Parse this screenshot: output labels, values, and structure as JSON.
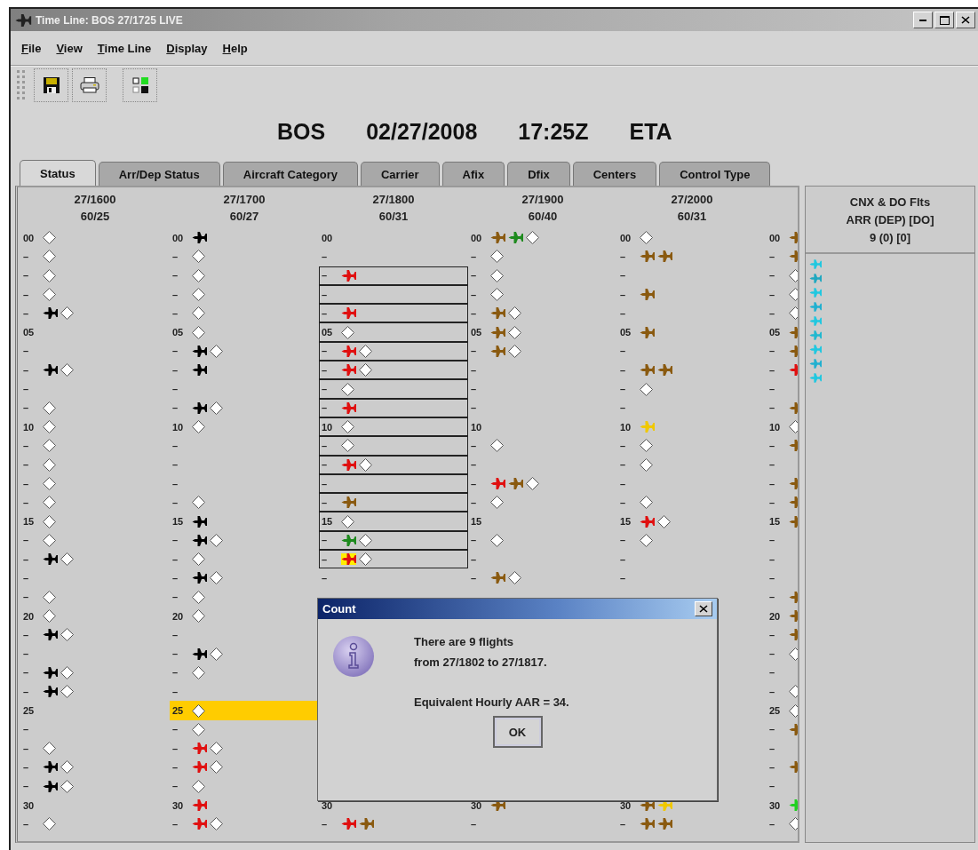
{
  "window": {
    "title": "Time Line: BOS 27/1725 LIVE"
  },
  "menu": [
    "File",
    "View",
    "Time Line",
    "Display",
    "Help"
  ],
  "heading": [
    "BOS",
    "02/27/2008",
    "17:25Z",
    "ETA"
  ],
  "tabs": [
    {
      "label": "Status",
      "selected": true
    },
    {
      "label": "Arr/Dep Status",
      "selected": false
    },
    {
      "label": "Aircraft Category",
      "selected": false
    },
    {
      "label": "Carrier",
      "selected": false
    },
    {
      "label": "Afix",
      "selected": false
    },
    {
      "label": "Dfix",
      "selected": false
    },
    {
      "label": "Centers",
      "selected": false
    },
    {
      "label": "Control Type",
      "selected": false
    }
  ],
  "columns": [
    {
      "time": "27/1600",
      "rate": "60/25",
      "rows": [
        {
          "label": "00",
          "marks": [
            {
              "kind": "diamond"
            }
          ]
        },
        {
          "label": "–",
          "marks": [
            {
              "kind": "diamond"
            }
          ]
        },
        {
          "label": "–",
          "marks": [
            {
              "kind": "diamond"
            }
          ]
        },
        {
          "label": "–",
          "marks": [
            {
              "kind": "diamond"
            }
          ]
        },
        {
          "label": "–",
          "marks": [
            {
              "kind": "plane",
              "color": "#000000"
            },
            {
              "kind": "diamond"
            }
          ]
        },
        {
          "label": "05"
        },
        {
          "label": "–"
        },
        {
          "label": "–",
          "marks": [
            {
              "kind": "plane",
              "color": "#000000"
            },
            {
              "kind": "diamond"
            }
          ]
        },
        {
          "label": "–"
        },
        {
          "label": "–",
          "marks": [
            {
              "kind": "diamond"
            }
          ]
        },
        {
          "label": "10",
          "marks": [
            {
              "kind": "diamond"
            }
          ]
        },
        {
          "label": "–",
          "marks": [
            {
              "kind": "diamond"
            }
          ]
        },
        {
          "label": "–",
          "marks": [
            {
              "kind": "diamond"
            }
          ]
        },
        {
          "label": "–",
          "marks": [
            {
              "kind": "diamond"
            }
          ]
        },
        {
          "label": "–",
          "marks": [
            {
              "kind": "diamond"
            }
          ]
        },
        {
          "label": "15",
          "marks": [
            {
              "kind": "diamond"
            }
          ]
        },
        {
          "label": "–",
          "marks": [
            {
              "kind": "diamond"
            }
          ]
        },
        {
          "label": "–",
          "marks": [
            {
              "kind": "plane",
              "color": "#000000"
            },
            {
              "kind": "diamond"
            }
          ]
        },
        {
          "label": "–"
        },
        {
          "label": "–",
          "marks": [
            {
              "kind": "diamond"
            }
          ]
        },
        {
          "label": "20",
          "marks": [
            {
              "kind": "diamond"
            }
          ]
        },
        {
          "label": "–",
          "marks": [
            {
              "kind": "plane",
              "color": "#000000"
            },
            {
              "kind": "diamond"
            }
          ]
        },
        {
          "label": "–"
        },
        {
          "label": "–",
          "marks": [
            {
              "kind": "plane",
              "color": "#000000"
            },
            {
              "kind": "diamond"
            }
          ]
        },
        {
          "label": "–",
          "marks": [
            {
              "kind": "plane",
              "color": "#000000"
            },
            {
              "kind": "diamond"
            }
          ]
        },
        {
          "label": "25"
        },
        {
          "label": "–"
        },
        {
          "label": "–",
          "marks": [
            {
              "kind": "diamond"
            }
          ]
        },
        {
          "label": "–",
          "marks": [
            {
              "kind": "plane",
              "color": "#000000"
            },
            {
              "kind": "diamond"
            }
          ]
        },
        {
          "label": "–",
          "marks": [
            {
              "kind": "plane",
              "color": "#000000"
            },
            {
              "kind": "diamond"
            }
          ]
        },
        {
          "label": "30"
        },
        {
          "label": "–",
          "marks": [
            {
              "kind": "diamond"
            }
          ]
        }
      ]
    },
    {
      "time": "27/1700",
      "rate": "60/27",
      "rows": [
        {
          "label": "00",
          "marks": [
            {
              "kind": "plane",
              "color": "#000000"
            }
          ]
        },
        {
          "label": "–",
          "marks": [
            {
              "kind": "diamond"
            }
          ]
        },
        {
          "label": "–",
          "marks": [
            {
              "kind": "diamond"
            }
          ]
        },
        {
          "label": "–",
          "marks": [
            {
              "kind": "diamond"
            }
          ]
        },
        {
          "label": "–",
          "marks": [
            {
              "kind": "diamond"
            }
          ]
        },
        {
          "label": "05",
          "marks": [
            {
              "kind": "diamond"
            }
          ]
        },
        {
          "label": "–",
          "marks": [
            {
              "kind": "plane",
              "color": "#000000"
            },
            {
              "kind": "diamond"
            }
          ]
        },
        {
          "label": "–",
          "marks": [
            {
              "kind": "plane",
              "color": "#000000"
            }
          ]
        },
        {
          "label": "–"
        },
        {
          "label": "–",
          "marks": [
            {
              "kind": "plane",
              "color": "#000000"
            },
            {
              "kind": "diamond"
            }
          ]
        },
        {
          "label": "10",
          "marks": [
            {
              "kind": "diamond"
            }
          ]
        },
        {
          "label": "–"
        },
        {
          "label": "–"
        },
        {
          "label": "–"
        },
        {
          "label": "–",
          "marks": [
            {
              "kind": "diamond"
            }
          ]
        },
        {
          "label": "15",
          "marks": [
            {
              "kind": "plane",
              "color": "#000000"
            }
          ]
        },
        {
          "label": "–",
          "marks": [
            {
              "kind": "plane",
              "color": "#000000"
            },
            {
              "kind": "diamond"
            }
          ]
        },
        {
          "label": "–",
          "marks": [
            {
              "kind": "diamond"
            }
          ]
        },
        {
          "label": "–",
          "marks": [
            {
              "kind": "plane",
              "color": "#000000"
            },
            {
              "kind": "diamond"
            }
          ]
        },
        {
          "label": "–",
          "marks": [
            {
              "kind": "diamond"
            }
          ]
        },
        {
          "label": "20",
          "marks": [
            {
              "kind": "diamond"
            }
          ]
        },
        {
          "label": "–"
        },
        {
          "label": "–",
          "marks": [
            {
              "kind": "plane",
              "color": "#000000"
            },
            {
              "kind": "diamond"
            }
          ]
        },
        {
          "label": "–",
          "marks": [
            {
              "kind": "diamond"
            }
          ]
        },
        {
          "label": "–"
        },
        {
          "label": "25",
          "highlighted": true,
          "marks": [
            {
              "kind": "diamond"
            }
          ]
        },
        {
          "label": "–",
          "marks": [
            {
              "kind": "diamond"
            }
          ]
        },
        {
          "label": "–",
          "marks": [
            {
              "kind": "plane",
              "color": "#e01010"
            },
            {
              "kind": "diamond"
            }
          ]
        },
        {
          "label": "–",
          "marks": [
            {
              "kind": "plane",
              "color": "#e01010"
            },
            {
              "kind": "diamond"
            }
          ]
        },
        {
          "label": "–",
          "marks": [
            {
              "kind": "diamond"
            }
          ]
        },
        {
          "label": "30",
          "marks": [
            {
              "kind": "plane",
              "color": "#e01010"
            }
          ]
        },
        {
          "label": "–",
          "marks": [
            {
              "kind": "plane",
              "color": "#e01010"
            },
            {
              "kind": "diamond"
            }
          ]
        }
      ]
    },
    {
      "time": "27/1800",
      "rate": "60/31",
      "rows": [
        {
          "label": "00"
        },
        {
          "label": "–"
        },
        {
          "label": "–",
          "boxed": true,
          "marks": [
            {
              "kind": "plane",
              "color": "#e01010"
            }
          ]
        },
        {
          "label": "–",
          "boxed": true
        },
        {
          "label": "–",
          "boxed": true,
          "marks": [
            {
              "kind": "plane",
              "color": "#e01010"
            }
          ]
        },
        {
          "label": "05",
          "boxed": true,
          "marks": [
            {
              "kind": "diamond"
            }
          ]
        },
        {
          "label": "–",
          "boxed": true,
          "marks": [
            {
              "kind": "plane",
              "color": "#e01010"
            },
            {
              "kind": "diamond"
            }
          ]
        },
        {
          "label": "–",
          "boxed": true,
          "marks": [
            {
              "kind": "plane",
              "color": "#e01010"
            },
            {
              "kind": "diamond"
            }
          ]
        },
        {
          "label": "–",
          "boxed": true,
          "marks": [
            {
              "kind": "diamond"
            }
          ]
        },
        {
          "label": "–",
          "boxed": true,
          "marks": [
            {
              "kind": "plane",
              "color": "#e01010"
            }
          ]
        },
        {
          "label": "10",
          "boxed": true,
          "marks": [
            {
              "kind": "diamond"
            }
          ]
        },
        {
          "label": "–",
          "boxed": true,
          "marks": [
            {
              "kind": "diamond"
            }
          ]
        },
        {
          "label": "–",
          "boxed": true,
          "marks": [
            {
              "kind": "plane",
              "color": "#e01010"
            },
            {
              "kind": "diamond"
            }
          ]
        },
        {
          "label": "–",
          "boxed": true
        },
        {
          "label": "–",
          "boxed": true,
          "marks": [
            {
              "kind": "plane",
              "color": "#8a5a10"
            }
          ]
        },
        {
          "label": "15",
          "boxed": true,
          "marks": [
            {
              "kind": "diamond"
            }
          ]
        },
        {
          "label": "–",
          "boxed": true,
          "marks": [
            {
              "kind": "plane",
              "color": "#1e8a1e"
            },
            {
              "kind": "diamond"
            }
          ]
        },
        {
          "label": "–",
          "boxed": true,
          "marks": [
            {
              "kind": "plane",
              "color": "#e01010",
              "highlighted": true
            },
            {
              "kind": "diamond"
            }
          ]
        },
        {
          "label": "–"
        },
        {},
        {},
        {},
        {},
        {},
        {},
        {},
        {},
        {},
        {},
        {},
        {
          "label": "30"
        },
        {
          "label": "–",
          "marks": [
            {
              "kind": "plane",
              "color": "#e01010"
            },
            {
              "kind": "plane",
              "color": "#8a5a10"
            }
          ]
        }
      ]
    },
    {
      "time": "27/1900",
      "rate": "60/40",
      "rows": [
        {
          "label": "00",
          "marks": [
            {
              "kind": "plane",
              "color": "#8a5a10"
            },
            {
              "kind": "plane",
              "color": "#1e8a1e"
            },
            {
              "kind": "diamond"
            }
          ]
        },
        {
          "label": "–",
          "marks": [
            {
              "kind": "diamond"
            }
          ]
        },
        {
          "label": "–",
          "marks": [
            {
              "kind": "diamond"
            }
          ]
        },
        {
          "label": "–",
          "marks": [
            {
              "kind": "diamond"
            }
          ]
        },
        {
          "label": "–",
          "marks": [
            {
              "kind": "plane",
              "color": "#8a5a10"
            },
            {
              "kind": "diamond"
            }
          ]
        },
        {
          "label": "05",
          "marks": [
            {
              "kind": "plane",
              "color": "#8a5a10"
            },
            {
              "kind": "diamond"
            }
          ]
        },
        {
          "label": "–",
          "marks": [
            {
              "kind": "plane",
              "color": "#8a5a10"
            },
            {
              "kind": "diamond"
            }
          ]
        },
        {
          "label": "–"
        },
        {
          "label": "–"
        },
        {
          "label": "–"
        },
        {
          "label": "10"
        },
        {
          "label": "–",
          "marks": [
            {
              "kind": "diamond"
            }
          ]
        },
        {
          "label": "–"
        },
        {
          "label": "–",
          "marks": [
            {
              "kind": "plane",
              "color": "#e01010"
            },
            {
              "kind": "plane",
              "color": "#8a5a10"
            },
            {
              "kind": "diamond"
            }
          ]
        },
        {
          "label": "–",
          "marks": [
            {
              "kind": "diamond"
            }
          ]
        },
        {
          "label": "15"
        },
        {
          "label": "–",
          "marks": [
            {
              "kind": "diamond"
            }
          ]
        },
        {
          "label": "–"
        },
        {
          "label": "–",
          "marks": [
            {
              "kind": "plane",
              "color": "#8a5a10"
            },
            {
              "kind": "diamond"
            }
          ]
        },
        {},
        {},
        {},
        {},
        {},
        {},
        {},
        {},
        {},
        {},
        {},
        {
          "label": "30",
          "marks": [
            {
              "kind": "plane",
              "color": "#8a5a10"
            }
          ]
        },
        {
          "label": "–"
        }
      ]
    },
    {
      "time": "27/2000",
      "rate": "60/31",
      "rows": [
        {
          "label": "00",
          "marks": [
            {
              "kind": "diamond"
            }
          ]
        },
        {
          "label": "–",
          "marks": [
            {
              "kind": "plane",
              "color": "#8a5a10"
            },
            {
              "kind": "plane",
              "color": "#8a5a10"
            }
          ]
        },
        {
          "label": "–"
        },
        {
          "label": "–",
          "marks": [
            {
              "kind": "plane",
              "color": "#8a5a10"
            }
          ]
        },
        {
          "label": "–"
        },
        {
          "label": "05",
          "marks": [
            {
              "kind": "plane",
              "color": "#8a5a10"
            }
          ]
        },
        {
          "label": "–"
        },
        {
          "label": "–",
          "marks": [
            {
              "kind": "plane",
              "color": "#8a5a10"
            },
            {
              "kind": "plane",
              "color": "#8a5a10"
            }
          ]
        },
        {
          "label": "–",
          "marks": [
            {
              "kind": "diamond"
            }
          ]
        },
        {
          "label": "–"
        },
        {
          "label": "10",
          "marks": [
            {
              "kind": "plane",
              "color": "#f0c800"
            }
          ]
        },
        {
          "label": "–",
          "marks": [
            {
              "kind": "diamond"
            }
          ]
        },
        {
          "label": "–",
          "marks": [
            {
              "kind": "diamond"
            }
          ]
        },
        {
          "label": "–"
        },
        {
          "label": "–",
          "marks": [
            {
              "kind": "diamond"
            }
          ]
        },
        {
          "label": "15",
          "marks": [
            {
              "kind": "plane",
              "color": "#e01010"
            },
            {
              "kind": "diamond"
            }
          ]
        },
        {
          "label": "–",
          "marks": [
            {
              "kind": "diamond"
            }
          ]
        },
        {
          "label": "–"
        },
        {
          "label": "–"
        },
        {},
        {},
        {},
        {},
        {},
        {},
        {},
        {},
        {},
        {},
        {},
        {
          "label": "30",
          "marks": [
            {
              "kind": "plane",
              "color": "#8a5a10"
            },
            {
              "kind": "plane",
              "color": "#f0c800"
            }
          ]
        },
        {
          "label": "–",
          "marks": [
            {
              "kind": "plane",
              "color": "#8a5a10"
            },
            {
              "kind": "plane",
              "color": "#8a5a10"
            }
          ]
        }
      ]
    },
    {
      "rows": [
        {
          "label": "00",
          "marks": [
            {
              "kind": "plane",
              "color": "#8a5a10"
            }
          ]
        },
        {
          "label": "–",
          "marks": [
            {
              "kind": "plane",
              "color": "#8a5a10"
            }
          ]
        },
        {
          "label": "–",
          "marks": [
            {
              "kind": "diamond"
            }
          ]
        },
        {
          "label": "–",
          "marks": [
            {
              "kind": "diamond"
            }
          ]
        },
        {
          "label": "–",
          "marks": [
            {
              "kind": "diamond"
            }
          ]
        },
        {
          "label": "05",
          "marks": [
            {
              "kind": "plane",
              "color": "#8a5a10"
            }
          ]
        },
        {
          "label": "–",
          "marks": [
            {
              "kind": "plane",
              "color": "#8a5a10"
            }
          ]
        },
        {
          "label": "–",
          "marks": [
            {
              "kind": "plane",
              "color": "#e01010"
            }
          ]
        },
        {
          "label": "–"
        },
        {
          "label": "–",
          "marks": [
            {
              "kind": "plane",
              "color": "#8a5a10"
            }
          ]
        },
        {
          "label": "10",
          "marks": [
            {
              "kind": "diamond"
            }
          ]
        },
        {
          "label": "–",
          "marks": [
            {
              "kind": "plane",
              "color": "#8a5a10"
            }
          ]
        },
        {
          "label": "–"
        },
        {
          "label": "–",
          "marks": [
            {
              "kind": "plane",
              "color": "#8a5a10"
            }
          ]
        },
        {
          "label": "–",
          "marks": [
            {
              "kind": "plane",
              "color": "#8a5a10"
            }
          ]
        },
        {
          "label": "15",
          "marks": [
            {
              "kind": "plane",
              "color": "#8a5a10"
            }
          ]
        },
        {
          "label": "–"
        },
        {
          "label": "–"
        },
        {
          "label": "–"
        },
        {
          "label": "–",
          "marks": [
            {
              "kind": "plane",
              "color": "#8a5a10"
            }
          ]
        },
        {
          "label": "20",
          "marks": [
            {
              "kind": "plane",
              "color": "#8a5a10"
            }
          ]
        },
        {
          "label": "–",
          "marks": [
            {
              "kind": "plane",
              "color": "#8a5a10"
            }
          ]
        },
        {
          "label": "–",
          "marks": [
            {
              "kind": "diamond"
            }
          ]
        },
        {
          "label": "–"
        },
        {
          "label": "–",
          "marks": [
            {
              "kind": "diamond"
            }
          ]
        },
        {
          "label": "25",
          "marks": [
            {
              "kind": "diamond"
            }
          ]
        },
        {
          "label": "–",
          "marks": [
            {
              "kind": "plane",
              "color": "#8a5a10"
            }
          ]
        },
        {
          "label": "–"
        },
        {
          "label": "–",
          "marks": [
            {
              "kind": "plane",
              "color": "#8a5a10"
            }
          ]
        },
        {
          "label": "–"
        },
        {
          "label": "30",
          "marks": [
            {
              "kind": "plane",
              "color": "#20d020"
            }
          ]
        },
        {
          "label": "–",
          "marks": [
            {
              "kind": "diamond"
            }
          ]
        }
      ]
    }
  ],
  "cancelled_panel": {
    "header": [
      "CNX & DO Flts",
      "ARR (DEP) [DO]",
      "9 (0) [0]"
    ],
    "flights": [
      {
        "color": "#20c8e0"
      },
      {
        "color": "#20a8c0"
      },
      {
        "color": "#20c8e0"
      },
      {
        "color": "#20b0d0"
      },
      {
        "color": "#20c8e0"
      },
      {
        "color": "#20b8d0"
      },
      {
        "color": "#20c8e0"
      },
      {
        "color": "#20b0d0"
      },
      {
        "color": "#20c8e0"
      }
    ]
  },
  "dialog": {
    "title": "Count",
    "lines": [
      "There are 9 flights",
      "from 27/1802 to 27/1817.",
      "Equivalent Hourly AAR = 34."
    ],
    "button": "OK"
  }
}
